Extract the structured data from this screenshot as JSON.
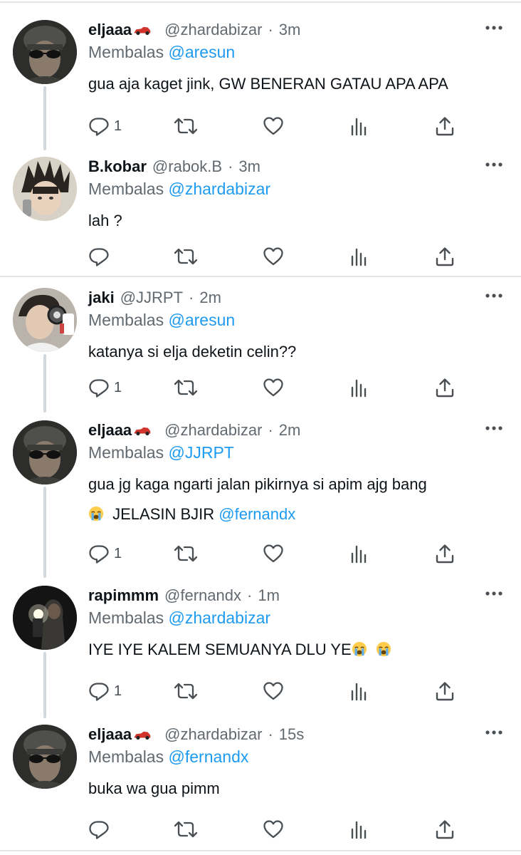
{
  "tweets": [
    {
      "avatar": "avatar-eljaaa",
      "name": "eljaaa",
      "handle": "@zhardabizar",
      "time": "3m",
      "reply_label": "Membalas",
      "reply_to": "@aresun",
      "lines": [
        "gua aja kaget jink, GW BENERAN GATAU APA APA"
      ],
      "reply_count": "1"
    },
    {
      "avatar": "avatar-bkobar",
      "name": "B.kobar",
      "handle": "@rabok.B",
      "time": "3m",
      "reply_label": "Membalas",
      "reply_to": "@zhardabizar",
      "lines": [
        "lah ?"
      ],
      "reply_count": ""
    },
    {
      "avatar": "avatar-jaki",
      "name": "jaki",
      "handle": "@JJRPT",
      "time": "2m",
      "reply_label": "Membalas",
      "reply_to": "@aresun",
      "lines": [
        "katanya si elja deketin celin??"
      ],
      "reply_count": "1"
    },
    {
      "avatar": "avatar-eljaaa",
      "name": "eljaaa",
      "handle": "@zhardabizar",
      "time": "2m",
      "reply_label": "Membalas",
      "reply_to": "@JJRPT",
      "lines": [
        "gua jg kaga ngarti jalan pikirnya si apim ajg bang"
      ],
      "line2_text": "JELASIN BJIR",
      "line2_mention": "@fernandx",
      "reply_count": "1"
    },
    {
      "avatar": "avatar-rapimmm",
      "name": "rapimmm",
      "handle": "@fernandx",
      "time": "1m",
      "reply_label": "Membalas",
      "reply_to": "@zhardabizar",
      "lines": [
        "IYE IYE KALEM SEMUANYA DLU YE"
      ],
      "reply_count": "1"
    },
    {
      "avatar": "avatar-eljaaa",
      "name": "eljaaa",
      "handle": "@zhardabizar",
      "time": "15s",
      "reply_label": "Membalas",
      "reply_to": "@fernandx",
      "lines": [
        "buka wa gua pimm"
      ],
      "reply_count": ""
    }
  ],
  "separator": "·",
  "name_decoration": "🏎",
  "icons": {
    "reply": "reply-icon",
    "retweet": "retweet-icon",
    "like": "heart-icon",
    "views": "views-icon",
    "share": "share-icon",
    "more": "more-icon",
    "emoji": "loudly-crying-face-emoji"
  },
  "colors": {
    "link": "#1d9bf0",
    "secondary_text": "#62696f",
    "primary_text": "#0f1419",
    "thread_line": "#cfd9de",
    "divider": "#e6e6e6"
  }
}
